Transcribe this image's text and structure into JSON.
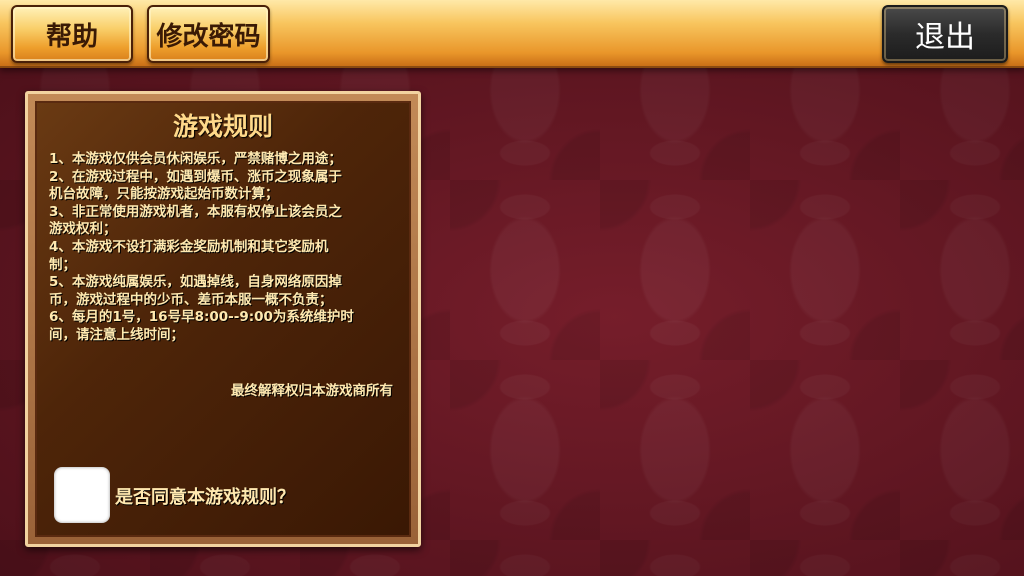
{
  "toolbar": {
    "help_label": "帮助",
    "change_password_label": "修改密码",
    "exit_label": "退出"
  },
  "rules_panel": {
    "title": "游戏规则",
    "lines": [
      "1、本游戏仅供会员休闲娱乐，严禁赌博之用途；",
      "2、在游戏过程中，如遇到爆币、涨币之现象属于",
      "机台故障，只能按游戏起始币数计算；",
      "3、非正常使用游戏机者，本服有权停止该会员之",
      "游戏权利；",
      "4、本游戏不设打满彩金奖励机制和其它奖励机",
      "制；",
      "5、本游戏纯属娱乐，如遇掉线，自身网络原因掉",
      "币，游戏过程中的少币、差币本服一概不负责；",
      "6、每月的1号，16号早8:00--9:00为系统维护时",
      "间，请注意上线时间；"
    ],
    "footer_note": "最终解释权归本游戏商所有",
    "agree_label": "是否同意本游戏规则？",
    "agree_checked": false
  },
  "colors": {
    "background": "#6e1a26",
    "gold_button": "#f9cf6a",
    "exit_button": "#2b2b2b",
    "rules_text": "#ffe9b0",
    "title_text": "#ffd98a"
  }
}
